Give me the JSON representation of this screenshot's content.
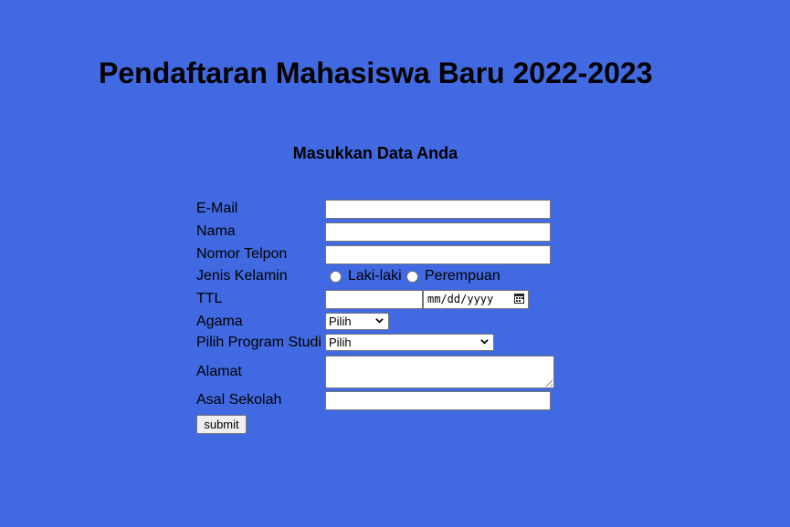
{
  "page": {
    "title": "Pendaftaran Mahasiswa Baru 2022-2023",
    "background_color": "#4169e1"
  },
  "form": {
    "subtitle": "Masukkan Data Anda",
    "fields": {
      "email": {
        "label": "E-Mail",
        "value": ""
      },
      "nama": {
        "label": "Nama",
        "value": ""
      },
      "telpon": {
        "label": "Nomor Telpon",
        "value": ""
      },
      "jenis_kelamin": {
        "label": "Jenis Kelamin",
        "options": [
          "Laki-laki",
          "Perempuan"
        ]
      },
      "ttl": {
        "label": "TTL",
        "place_value": "",
        "date_placeholder": "mm/dd/yyyy"
      },
      "agama": {
        "label": "Agama",
        "selected": "Pilih"
      },
      "prodi": {
        "label": "Pilih Program Studi",
        "selected": "Pilih"
      },
      "alamat": {
        "label": "Alamat",
        "value": ""
      },
      "asal_sekolah": {
        "label": "Asal Sekolah",
        "value": ""
      }
    },
    "submit_label": "submit",
    "icons": {
      "calendar": "calendar-icon",
      "dropdown": "chevron-down-icon",
      "resize": "resize-grip-icon"
    }
  }
}
